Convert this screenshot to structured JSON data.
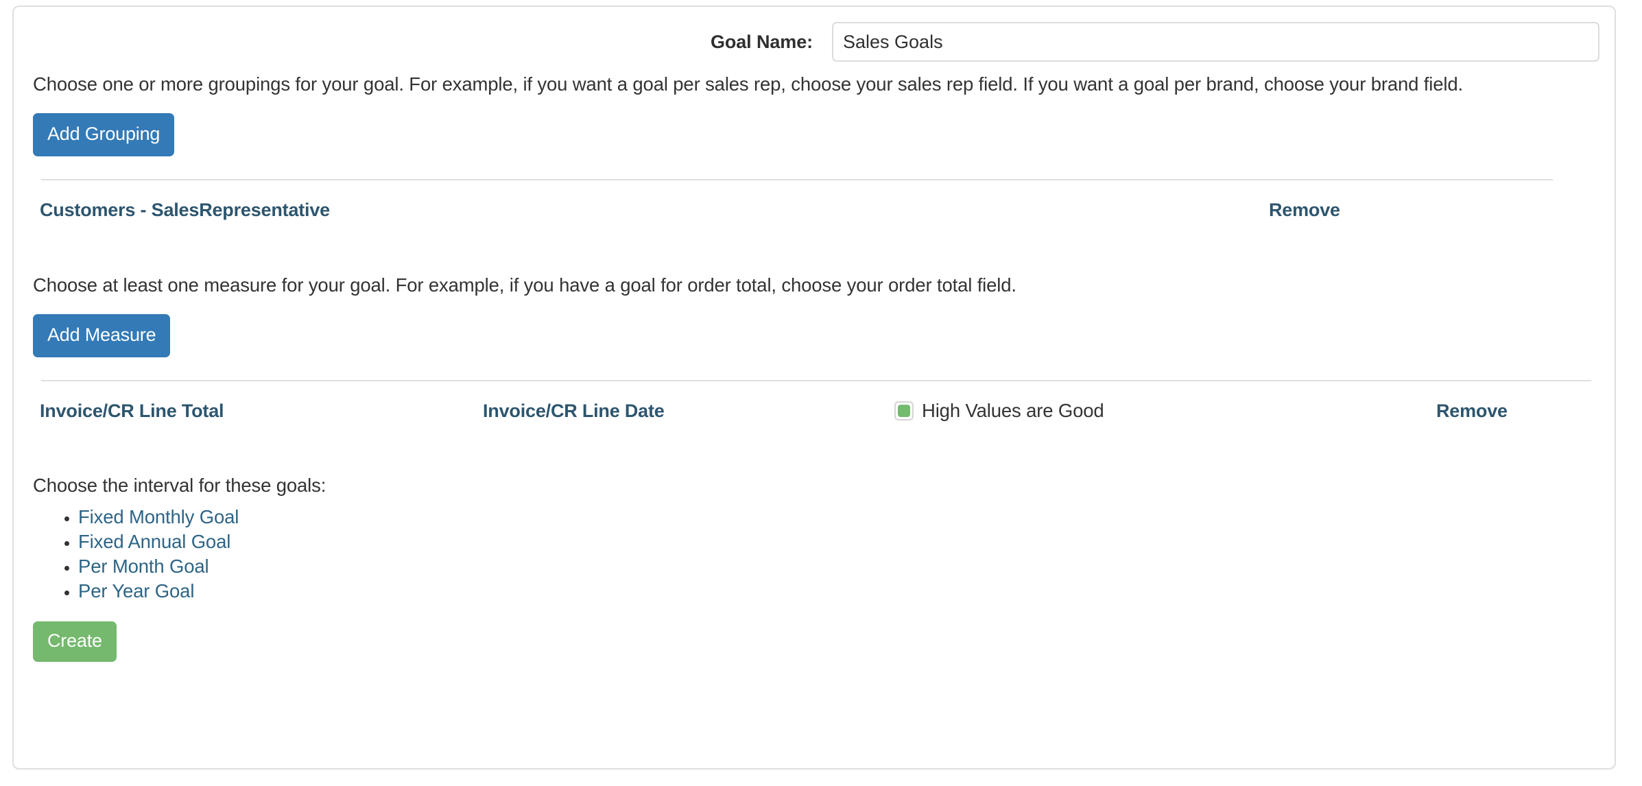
{
  "form": {
    "goal_name": {
      "label": "Goal Name:",
      "value": "Sales Goals",
      "placeholder": ""
    },
    "grouping": {
      "description": "Choose one or more groupings for your goal. For example, if you want a goal per sales rep, choose your sales rep field. If you want a goal per brand, choose your brand field.",
      "add_button": "Add Grouping",
      "rows": [
        {
          "field": "Customers - SalesRepresentative",
          "remove": "Remove"
        }
      ]
    },
    "measure": {
      "description": "Choose at least one measure for your goal. For example, if you have a goal for order total, choose your order total field.",
      "add_button": "Add Measure",
      "rows": [
        {
          "value_field": "Invoice/CR Line Total",
          "date_field": "Invoice/CR Line Date",
          "high_values_label": "High Values are Good",
          "high_values_checked": true,
          "remove": "Remove"
        }
      ]
    },
    "interval": {
      "heading": "Choose the interval for these goals:",
      "options": [
        "Fixed Monthly Goal",
        "Fixed Annual Goal",
        "Per Month Goal",
        "Per Year Goal"
      ]
    },
    "submit": {
      "label": "Create"
    }
  },
  "colors": {
    "primary_button": "#337ab7",
    "create_button": "#74b96d",
    "link": "#2d556e",
    "checkbox_fill": "#73bb6e",
    "border": "#dfdfdf"
  }
}
